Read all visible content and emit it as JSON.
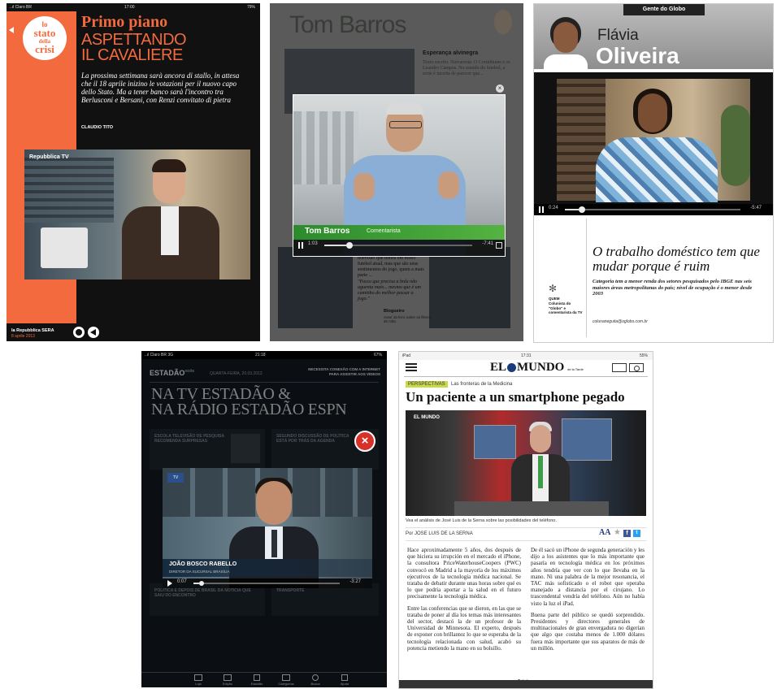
{
  "p1": {
    "status": {
      "carrier": "..ıl Claro BR",
      "time": "17:00",
      "battery": "79%"
    },
    "section": "Primo piano",
    "logo": [
      "lo",
      "stato",
      "della",
      "crisi"
    ],
    "headline": [
      "ASPETTANDO",
      "IL CAVALIERE"
    ],
    "standfirst": "La prossima settimana sarà ancora di stallo, in attesa che il 18 aprile inizino le votazioni per il nuovo capo dello Stato. Ma a tener banco sarà l'incontro tra Berlusconi e Bersani, con Renzi convitato di pietra",
    "byline": "CLAUDIO TITO",
    "video_tag": "Repubblica TV",
    "footer_brand": "la Repubblica SERA",
    "footer_date": "8 aprile 2013"
  },
  "p2": {
    "bg_name": "Tom Barros",
    "right_title": "Esperança alvinegra",
    "right_text": "Texto escrito. Nalvaroria: O Corinthians e os Leandro Campos. No mundo do futebol, a sorte é incerta de parecer que...",
    "lower_text": "Os vídeos dos jogos do lance da televisão que temos em nosso futebol atual, mas que são seus sentimentos do jogo, quem a mais parte ...",
    "quote": "\"Passo que precisa a bola não aguenta mais... mesmo que é um caminho do melhor passar a jogo.\"",
    "lower_byline": "Blogueiro",
    "lower_small": "Autor do livro sobre os filmes de mão",
    "caption_name": "Tom Barros",
    "caption_sub": "Comentarista",
    "ctrl_time": "1:03",
    "ctrl_remaining": "-7:41"
  },
  "p3": {
    "masthead": "Gente do Globo",
    "name_first": "Flávia",
    "name_last": "Oliveira",
    "ctrl_time": "0:24",
    "ctrl_remaining": "-5:47",
    "headline": "O trabalho doméstico tem que mudar porque é ruim",
    "deck": "Categoria tem a menor renda dos setores pesquisados pelo IBGE nas seis maiores áreas metropolitanas do país; nível de ocupação é o menor desde 2003",
    "side_label": "QUEM",
    "side_text": "Colunista do \"Globo\" e comentarista da TV",
    "email": "colunaneguita@oglobo.com.br"
  },
  "p4": {
    "status": {
      "carrier": "..ıl Claro BR 3G",
      "time": "21:18",
      "battery": "67%"
    },
    "brand": "ESTADÃO",
    "brand_sup": "noite",
    "date": "QUARTA-FEIRA, 20.03.2013",
    "notice": "NECESSITA CONEXÃO COM A INTERNET PARA ASSISTIR AOS VÍDEOS",
    "title": [
      "NA TV ESTADÃO &",
      "NA RÁDIO ESTADÃO ESPN"
    ],
    "card1": "ESCOLA TELEVISÃO DE PESQUISA RECOMENDA SURPRESAS",
    "card2": "SEGUNDO DISCUSSÃO DE POLÍTICA ESTÁ POR TRÁS DA AGENDA",
    "card3": "POLÍTICA É DEPOIS DE BRASIL DA NOTÍCIA QUE SAIU DO ENCONTRO",
    "card4": "TRANSPORTE",
    "lower_name": "JOÃO BOSCO RABELLO",
    "lower_sub": "DIRETOR DA SUCURSAL BRASÍLIA",
    "ctrl_time": "0:07",
    "ctrl_remaining": "-3:27",
    "nav": [
      "Loja",
      "Edição",
      "Estadão",
      "Categorias",
      "Busca",
      "Ajuda"
    ]
  },
  "p5": {
    "status": {
      "device": "iPad",
      "time": "17:31",
      "battery": "55%"
    },
    "logo_left": "EL",
    "logo_right": "MUNDO",
    "logo_sub": "de la Tarde",
    "tag": "PERSPECTIVAS",
    "tag_text": "Las fronteras de la Medicina",
    "headline": "Un paciente a un smartphone pegado",
    "video_logo": "EL MUNDO",
    "caption": "Vea el análisis de José Luis de la Serna sobre las posibilidades del teléfono.",
    "byline": "Por JOSE LUIS DE LA SERNA",
    "font_btn": "AA",
    "col1_p1": "Hace aproximadamente 5 años, dos después de que hiciera su irrupción en el mercado el iPhone, la consultora PriceWaterhouseCoopers (PWC) convocó en Madrid a la mayoría de los máximos ejecutivos de la tecnología médica nacional. Se trataba de debatir durante unas horas sobre qué es lo que podría aportar a la salud en el futuro precisamente la tecnología médica.",
    "col1_p2": "Entre las conferencias que se dieron, en las que se trataba de poner al día los temas más interesantes del sector, destacó la de un profesor de la Universidad de Minnesota. El experto, después de exponer con brillantez lo que se esperaba de la tecnología relacionada con salud, acabó su potencia metiendo la mano en su bolsillo.",
    "col2_p1": "De él sacó un iPhone de segunda generación y les dijo a los asistentes que lo más importante que pasaría en tecnología médica en los próximos años tendría que ver con lo que llevaba en la mano. Ni una palabra de la mejor resonancia, el TAC más sofisticado o el robot que operaba manejado a distancia por el cirujano. Lo trascendental vendría del teléfono. Aún no había visto la luz el iPad.",
    "col2_p2": "Buena parte del público se quedó sorprendido. Presidentes y directores generales de multinacionales de gran envergadura no digerían que algo que costaba menos de 1.000 dólares fuera más importante que sus aparatos de más de un millón."
  }
}
